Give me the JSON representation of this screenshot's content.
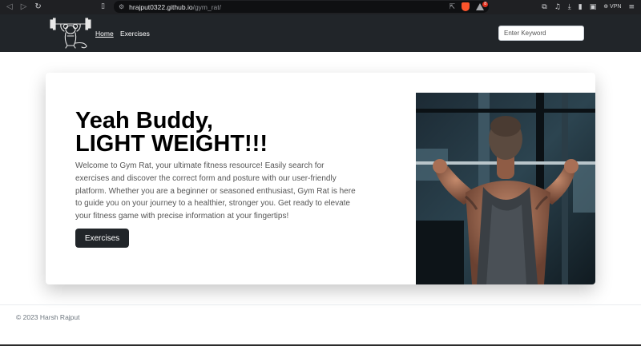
{
  "browser": {
    "url_host": "hrajput0322.github.io",
    "url_path": "/gym_rat/",
    "vpn_label": "VPN",
    "rewards_badge": "8"
  },
  "navbar": {
    "links": [
      {
        "label": "Home",
        "active": true
      },
      {
        "label": "Exercises",
        "active": false
      }
    ],
    "search_placeholder": "Enter Keyword"
  },
  "hero": {
    "title_line1": "Yeah Buddy,",
    "title_line2": "LIGHT WEIGHT!!!",
    "description": "Welcome to Gym Rat, your ultimate fitness resource! Easily search for exercises and discover the correct form and posture with our user-friendly platform. Whether you are a beginner or seasoned enthusiast, Gym Rat is here to guide you on your journey to a healthier, stronger you. Get ready to elevate your fitness game with precise information at your fingertips!",
    "button_label": "Exercises"
  },
  "footer": {
    "text": "© 2023 Harsh Rajput"
  },
  "colors": {
    "navbar_bg": "#212529",
    "button_bg": "#212529",
    "chrome_bg": "#1f2023",
    "brave_orange": "#fb542b"
  }
}
